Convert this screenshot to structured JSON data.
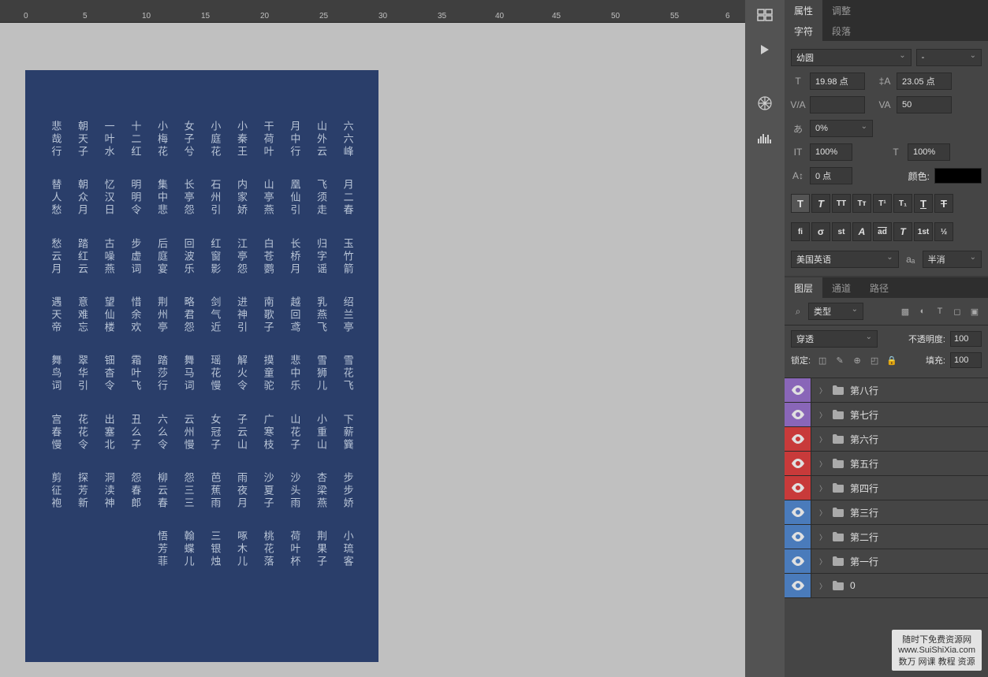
{
  "ruler_ticks": [
    "0",
    "5",
    "10",
    "15",
    "20",
    "25",
    "30",
    "35",
    "40",
    "45",
    "50",
    "55",
    "6"
  ],
  "canvas_text": [
    [
      "六六峰",
      "山外云",
      "月中行",
      "干荷叶",
      "小秦王",
      "小庭花",
      "女子兮",
      "小梅花",
      "十二红",
      "一叶水",
      "朝天子",
      "悲哉行"
    ],
    [
      "月二春",
      "飞须走",
      "凰仙引",
      "山亭燕",
      "内家娇",
      "石州引",
      "长亭怨",
      "集中悲",
      "明明令",
      "忆汉日",
      "朝众月",
      "替人愁"
    ],
    [
      "玉竹箭",
      "归字谣",
      "长桥月",
      "白苍鹦",
      "江亭怨",
      "红窗影",
      "回波乐",
      "后庭宴",
      "步虚词",
      "古噪燕",
      "踏红云",
      "愁云月"
    ],
    [
      "绍兰亭",
      "乳燕飞",
      "越回鸢",
      "南歌子",
      "进神引",
      "剑气近",
      "略君怨",
      "荆州亭",
      "惜余欢",
      "望仙楼",
      "意难忘",
      "遇天帝"
    ],
    [
      "雪花飞",
      "雪狮儿",
      "悲中乐",
      "摸童驼",
      "解火令",
      "瑶花慢",
      "舞马词",
      "踏莎行",
      "霜叶飞",
      "钿杳令",
      "翠华引",
      "舞鸟词"
    ],
    [
      "下薪簨",
      "小重山",
      "山花子",
      "广寒枝",
      "子云山",
      "女冠子",
      "云州慢",
      "六么令",
      "丑么子",
      "出塞北",
      "花花令",
      "宫春慢"
    ],
    [
      "步步娇",
      "杏梁燕",
      "沙头雨",
      "沙夏子",
      "雨夜月",
      "芭蕉雨",
      "怨三三",
      "柳云春",
      "怨春郎",
      "洞渎神",
      "探芳新",
      "剪征袍"
    ],
    [
      "小琉客",
      "荆果子",
      "荷叶杯",
      "桃花落",
      "啄木儿",
      "三银烛",
      "翰蝶儿",
      "悟芳菲",
      "",
      "",
      "",
      ""
    ],
    [
      "",
      "",
      "",
      "",
      "",
      "",
      "",
      "",
      "",
      "",
      "",
      ""
    ]
  ],
  "tabs": {
    "properties": "属性",
    "adjust": "调整",
    "character": "字符",
    "paragraph": "段落",
    "layers": "图层",
    "channels": "通道",
    "paths": "路径"
  },
  "char_panel": {
    "font": "幼圆",
    "style": "-",
    "size": "19.98 点",
    "leading": "23.05 点",
    "va": "",
    "tracking": "50",
    "baseline_pct": "0%",
    "scale_h": "100%",
    "scale_v": "100%",
    "baseline": "0 点",
    "color_label": "颜色:",
    "language": "美国英语",
    "aa": "半消"
  },
  "layers_panel": {
    "type_label": "类型",
    "blend": "穿透",
    "opacity_label": "不透明度:",
    "opacity": "100",
    "lock_label": "锁定:",
    "fill_label": "填充:",
    "fill": "100",
    "items": [
      {
        "name": "第八行",
        "eye_bg": "#8966b8"
      },
      {
        "name": "第七行",
        "eye_bg": "#8966b8"
      },
      {
        "name": "第六行",
        "eye_bg": "#c83a3a"
      },
      {
        "name": "第五行",
        "eye_bg": "#c83a3a"
      },
      {
        "name": "第四行",
        "eye_bg": "#c83a3a"
      },
      {
        "name": "第三行",
        "eye_bg": "#4a7bbb"
      },
      {
        "name": "第二行",
        "eye_bg": "#4a7bbb"
      },
      {
        "name": "第一行",
        "eye_bg": "#4a7bbb"
      },
      {
        "name": "0",
        "eye_bg": "#4a7bbb"
      }
    ]
  },
  "watermark": {
    "line1": "随时下免费资源网",
    "line2": "www.SuiShiXia.com",
    "line3": "数万 网课 教程 资源"
  }
}
